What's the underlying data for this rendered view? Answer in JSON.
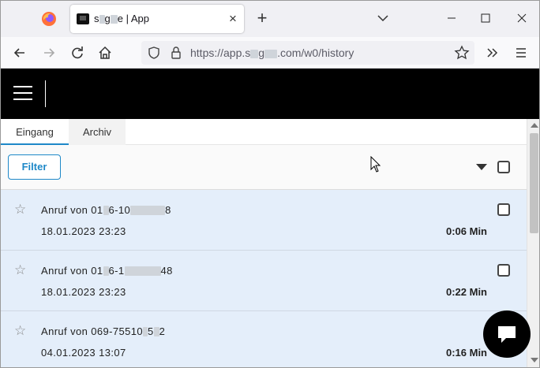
{
  "browser": {
    "tab": {
      "title_start": "s",
      "title_mid": "g",
      "title_end": "e | App"
    },
    "url": {
      "prefix": "https://app.s",
      "mid": "g",
      "suffix": ".com/w0/history"
    }
  },
  "app": {
    "tabs": [
      {
        "label": "Eingang",
        "active": true
      },
      {
        "label": "Archiv",
        "active": false
      }
    ],
    "toolbar": {
      "filter_label": "Filter"
    },
    "calls": [
      {
        "title_a": "Anruf von 01",
        "title_b": "6-10",
        "title_c": "8",
        "date": "18.01.2023 23:23",
        "duration": "0:06 Min"
      },
      {
        "title_a": "Anruf von 01",
        "title_b": "6-1",
        "title_c": "48",
        "date": "18.01.2023 23:23",
        "duration": "0:22 Min"
      },
      {
        "title_a": "Anruf von 069-75510",
        "title_b": "5",
        "title_c": "2",
        "date": "04.01.2023 13:07",
        "duration": "0:16 Min"
      }
    ]
  },
  "colors": {
    "accent": "#1e88c8",
    "appbar": "#000000",
    "call_row": "#e4eefa"
  },
  "icons": [
    "firefox-icon",
    "tab-favicon",
    "close-icon",
    "plus-icon",
    "chevron-down-icon",
    "minimize-icon",
    "maximize-icon",
    "back-icon",
    "forward-icon",
    "reload-icon",
    "home-icon",
    "shield-icon",
    "lock-icon",
    "bookmark-star-icon",
    "extensions-chevron-icon",
    "menu-icon",
    "hamburger-icon",
    "star-icon",
    "chat-icon"
  ]
}
